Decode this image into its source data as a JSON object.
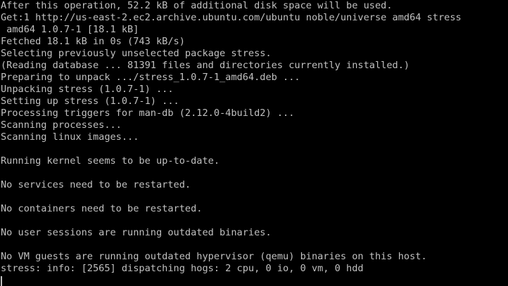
{
  "terminal": {
    "lines": [
      "After this operation, 52.2 kB of additional disk space will be used.",
      "Get:1 http://us-east-2.ec2.archive.ubuntu.com/ubuntu noble/universe amd64 stress",
      " amd64 1.0.7-1 [18.1 kB]",
      "Fetched 18.1 kB in 0s (743 kB/s)",
      "Selecting previously unselected package stress.",
      "(Reading database ... 81391 files and directories currently installed.)",
      "Preparing to unpack .../stress_1.0.7-1_amd64.deb ...",
      "Unpacking stress (1.0.7-1) ...",
      "Setting up stress (1.0.7-1) ...",
      "Processing triggers for man-db (2.12.0-4build2) ...",
      "Scanning processes...",
      "Scanning linux images...",
      "",
      "Running kernel seems to be up-to-date.",
      "",
      "No services need to be restarted.",
      "",
      "No containers need to be restarted.",
      "",
      "No user sessions are running outdated binaries.",
      "",
      "No VM guests are running outdated hypervisor (qemu) binaries on this host.",
      "stress: info: [2565] dispatching hogs: 2 cpu, 0 io, 0 vm, 0 hdd"
    ]
  },
  "colors": {
    "background": "#000000",
    "foreground": "#c0c0c0"
  }
}
